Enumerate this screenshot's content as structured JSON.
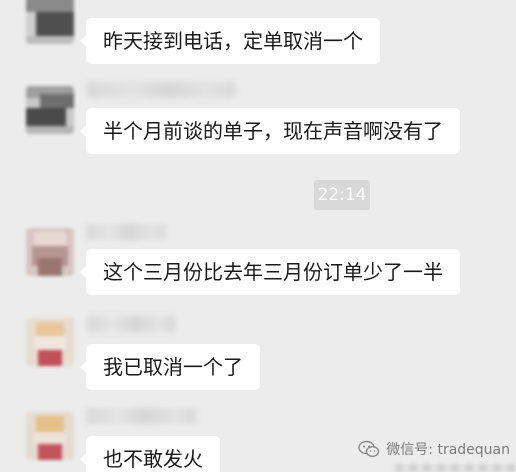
{
  "chat": {
    "messages": [
      {
        "text": "昨天接到电话，定单取消一个"
      },
      {
        "text": "半个月前谈的单子，现在声音啊没有了"
      },
      {
        "text": "这个三月份比去年三月份订单少了一半"
      },
      {
        "text": "我已取消一个了"
      },
      {
        "text": "也不敢发火"
      }
    ],
    "timestamp": "22:14"
  },
  "watermark": {
    "text": "微信号: tradequan",
    "icon": "wechat-icon"
  },
  "colors": {
    "background": "#ececec",
    "bubble": "#ffffff",
    "timestamp_bg": "#d8d8d8"
  }
}
